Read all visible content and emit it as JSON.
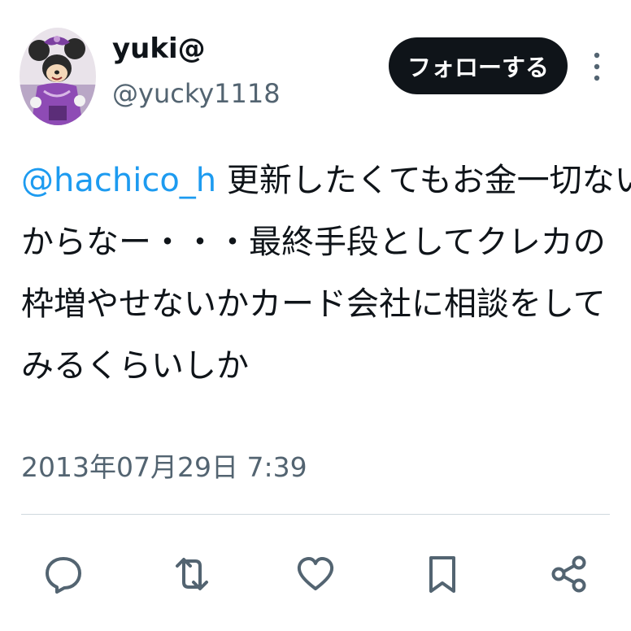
{
  "user": {
    "display_name": "yuki@",
    "handle": "@yucky1118",
    "avatar_icon": "character-avatar"
  },
  "header": {
    "follow_label": "フォローする",
    "more_icon": "more-vertical-icon"
  },
  "tweet": {
    "mention": "@hachico_h",
    "lines": [
      " 更新したくてもお金一切ない",
      "からなー・・・最終手段としてクレカの",
      "枠増やせないかカード会社に相談をして",
      "みるくらいしか"
    ],
    "timestamp": "2013年07月29日 7:39"
  },
  "actions": [
    {
      "icon": "reply-icon"
    },
    {
      "icon": "retweet-icon"
    },
    {
      "icon": "like-icon"
    },
    {
      "icon": "bookmark-icon"
    },
    {
      "icon": "share-icon"
    }
  ],
  "colors": {
    "text": "#0f1419",
    "secondary": "#536471",
    "link": "#1d9bf0",
    "button_bg": "#0f1419",
    "divider": "#cfd9de"
  }
}
